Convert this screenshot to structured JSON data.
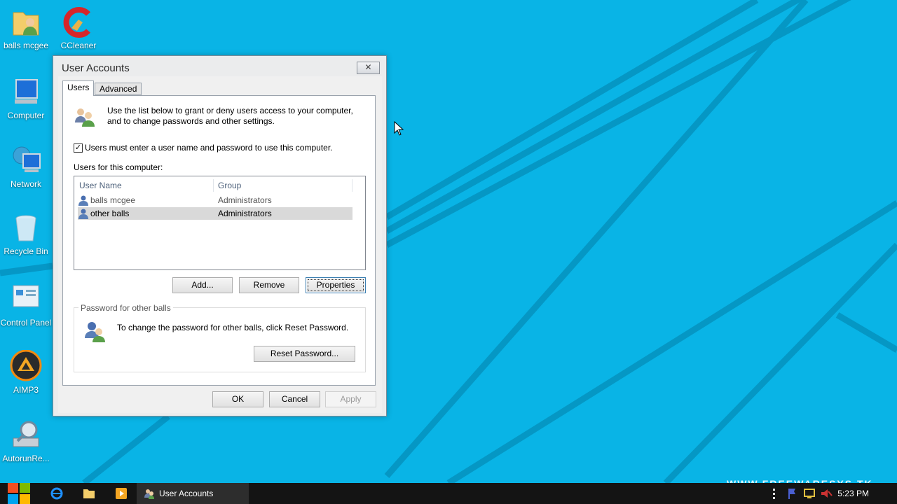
{
  "desktop": {
    "icons": [
      {
        "label": "balls mcgee"
      },
      {
        "label": "CCleaner"
      },
      {
        "label": "Computer"
      },
      {
        "label": "Network"
      },
      {
        "label": "Recycle Bin"
      },
      {
        "label": "Control Panel"
      },
      {
        "label": "AIMP3"
      },
      {
        "label": "AutorunRe..."
      }
    ],
    "watermark": "WWW.FREEWARESYS.TK"
  },
  "window": {
    "title": "User Accounts",
    "close_label": "✕",
    "tabs": [
      {
        "label": "Users",
        "active": true
      },
      {
        "label": "Advanced",
        "active": false
      }
    ],
    "intro_text": "Use the list below to grant or deny users access to your computer, and to change passwords and other settings.",
    "require_login": {
      "checked": true,
      "label": "Users must enter a user name and password to use this computer."
    },
    "users_label": "Users for this computer:",
    "columns": [
      "User Name",
      "Group"
    ],
    "users": [
      {
        "name": "balls mcgee",
        "group": "Administrators",
        "selected": false
      },
      {
        "name": "other balls",
        "group": "Administrators",
        "selected": true
      }
    ],
    "buttons": {
      "add": "Add...",
      "remove": "Remove",
      "properties": "Properties"
    },
    "password_group": {
      "legend": "Password for other balls",
      "text": "To change the password for other balls, click Reset Password.",
      "reset_button": "Reset Password..."
    },
    "footer": {
      "ok": "OK",
      "cancel": "Cancel",
      "apply": "Apply"
    }
  },
  "taskbar": {
    "active_window": "User Accounts",
    "clock": "5:23 PM"
  },
  "colors": {
    "desktop_bg": "#09b4e6",
    "desktop_stripe": "#0596c3",
    "taskbar_bg": "#141414",
    "selection": "#d9d9d9"
  }
}
